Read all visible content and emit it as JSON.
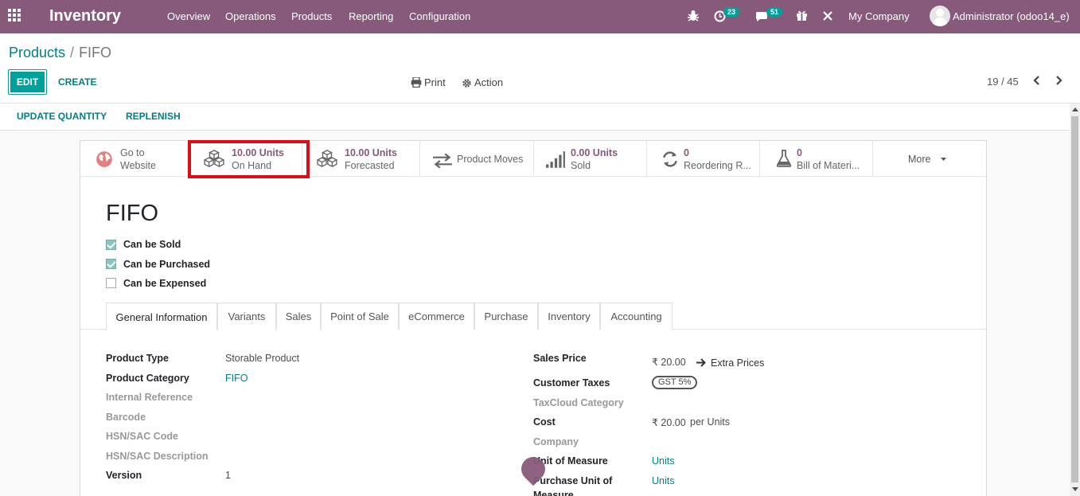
{
  "navbar": {
    "app_title": "Inventory",
    "menu": [
      "Overview",
      "Operations",
      "Products",
      "Reporting",
      "Configuration"
    ],
    "activity_count": "23",
    "messages_count": "51",
    "company": "My Company",
    "user": "Administrator (odoo14_e)"
  },
  "breadcrumb": {
    "parent": "Products",
    "separator": "/",
    "current": "FIFO"
  },
  "actions": {
    "edit": "EDIT",
    "create": "CREATE",
    "print": "Print",
    "action": "Action"
  },
  "pager": {
    "text": "19 / 45"
  },
  "statusbar": {
    "update_quantity": "UPDATE QUANTITY",
    "replenish": "REPLENISH"
  },
  "smart_buttons": {
    "website": {
      "line1": "Go to",
      "line2": "Website"
    },
    "on_hand": {
      "value": "10.00 Units",
      "label": "On Hand"
    },
    "forecasted": {
      "value": "10.00 Units",
      "label": "Forecasted"
    },
    "moves": {
      "label": "Product Moves"
    },
    "sold": {
      "value": "0.00 Units",
      "label": "Sold"
    },
    "reordering": {
      "value": "0",
      "label": "Reordering R..."
    },
    "bom": {
      "value": "0",
      "label": "Bill of Materi..."
    },
    "more": {
      "label": "More"
    }
  },
  "product": {
    "name": "FIFO",
    "can_be_sold": {
      "label": "Can be Sold",
      "checked": true
    },
    "can_be_purchased": {
      "label": "Can be Purchased",
      "checked": true
    },
    "can_be_expensed": {
      "label": "Can be Expensed",
      "checked": false
    }
  },
  "tabs": [
    "General Information",
    "Variants",
    "Sales",
    "Point of Sale",
    "eCommerce",
    "Purchase",
    "Inventory",
    "Accounting"
  ],
  "left_fields": {
    "product_type": {
      "label": "Product Type",
      "value": "Storable Product"
    },
    "product_category": {
      "label": "Product Category",
      "value": "FIFO"
    },
    "internal_reference": {
      "label": "Internal Reference"
    },
    "barcode": {
      "label": "Barcode"
    },
    "hsn_code": {
      "label": "HSN/SAC Code"
    },
    "hsn_description": {
      "label": "HSN/SAC Description"
    },
    "version": {
      "label": "Version",
      "value": "1"
    }
  },
  "right_fields": {
    "sales_price": {
      "label": "Sales Price",
      "value": "₹ 20.00",
      "extra": "Extra Prices"
    },
    "customer_taxes": {
      "label": "Customer Taxes",
      "value": "GST 5%"
    },
    "taxcloud": {
      "label": "TaxCloud Category"
    },
    "cost": {
      "label": "Cost",
      "value": "₹ 20.00",
      "unit": "per Units"
    },
    "company": {
      "label": "Company"
    },
    "uom": {
      "label": "Unit of Measure",
      "value": "Units"
    },
    "purchase_uom": {
      "label": "Purchase Unit of",
      "label2": "Measure",
      "value": "Units"
    }
  },
  "colors": {
    "brand": "#875a7b",
    "accent": "#00a09d",
    "link": "#017e84",
    "highlight": "#e00b16"
  }
}
